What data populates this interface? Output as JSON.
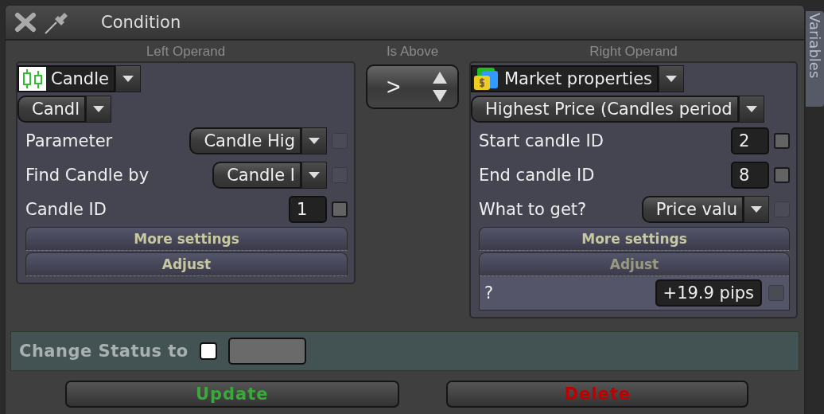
{
  "window": {
    "title": "Condition"
  },
  "side_tab": {
    "label": "Variables"
  },
  "left_operand": {
    "heading": "Left Operand",
    "source": {
      "label": "Candle",
      "kind": "candles"
    },
    "type_select": "Candl",
    "rows": [
      {
        "kind": "dropdown",
        "label": "Parameter",
        "value": "Candle Hig",
        "checkbox": {
          "checked": false,
          "disabled": true
        }
      },
      {
        "kind": "dropdown",
        "label": "Find Candle by",
        "value": "Candle I",
        "checkbox": {
          "checked": false,
          "disabled": true
        }
      },
      {
        "kind": "number",
        "label": "Candle ID",
        "value": "1",
        "checkbox": {
          "checked": false,
          "disabled": false
        }
      }
    ],
    "sections": [
      {
        "label": "More settings",
        "expanded": false
      },
      {
        "label": "Adjust",
        "expanded": false
      }
    ]
  },
  "operator": {
    "heading": "Is Above",
    "symbol": ">"
  },
  "right_operand": {
    "heading": "Right Operand",
    "source": {
      "label": "Market properties",
      "kind": "market"
    },
    "type_select": "Highest Price (Candles period",
    "rows": [
      {
        "kind": "number",
        "label": "Start candle ID",
        "value": "2",
        "checkbox": {
          "checked": false,
          "disabled": false
        }
      },
      {
        "kind": "number",
        "label": "End candle ID",
        "value": "8",
        "checkbox": {
          "checked": false,
          "disabled": false
        }
      },
      {
        "kind": "dropdown",
        "label": "What to get?",
        "value": "Price valu",
        "checkbox": {
          "checked": false,
          "disabled": true
        }
      }
    ],
    "sections": [
      {
        "label": "More settings",
        "expanded": false
      },
      {
        "label": "Adjust",
        "expanded": true,
        "rows": [
          {
            "label": "?",
            "value": "+19.9 pips",
            "checkbox": {
              "checked": false,
              "disabled": true
            }
          }
        ]
      }
    ]
  },
  "status": {
    "label": "Change Status to",
    "checkbox": {
      "checked": false
    }
  },
  "buttons": [
    {
      "label": "Update",
      "kind": "update"
    },
    {
      "label": "Delete",
      "kind": "delete"
    }
  ]
}
